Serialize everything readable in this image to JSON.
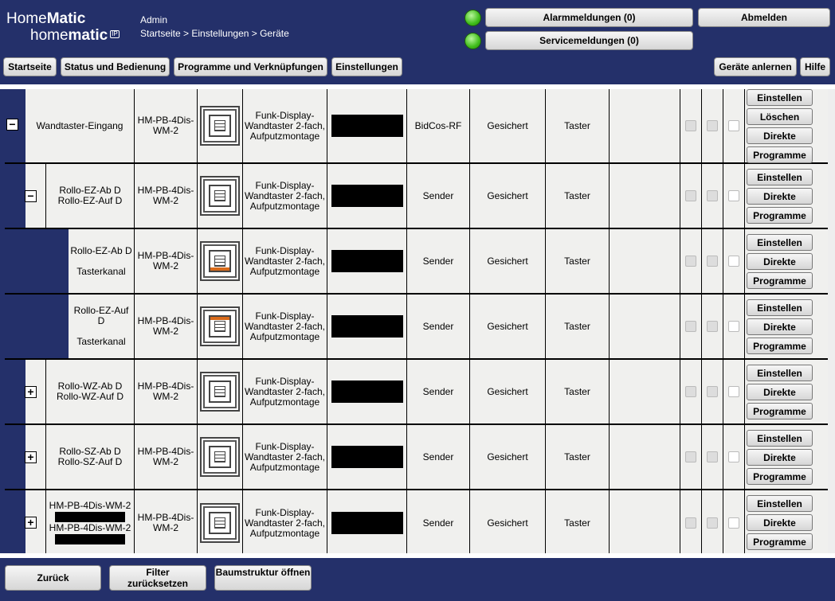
{
  "header": {
    "logo_line1_a": "Home",
    "logo_line1_b": "Matic",
    "logo_line2_a": "home",
    "logo_line2_b": "matic",
    "logo_badge": "IP",
    "user": "Admin",
    "breadcrumb": "Startseite > Einstellungen > Geräte",
    "alarm_label": "Alarmmeldungen (0)",
    "service_label": "Servicemeldungen (0)",
    "logout_label": "Abmelden"
  },
  "nav": {
    "items": [
      "Startseite",
      "Status und Bedienung",
      "Programme und Verknüpfungen",
      "Einstellungen"
    ],
    "teach_in": "Geräte anlernen",
    "help": "Hilfe"
  },
  "rows": [
    {
      "toggle": "−",
      "name1": "Wandtaster-Eingang",
      "name2": "",
      "name3": "",
      "type": "HM-PB-4Dis-WM-2",
      "desc": "Funk-Display-Wandtaster 2-fach, Aufputzmontage",
      "iface": "BidCos-RF",
      "mode": "Gesichert",
      "category": "Taster",
      "actions": [
        "Einstellen",
        "Löschen",
        "Direkte",
        "Programme"
      ]
    },
    {
      "toggle": "−",
      "name1": "Rollo-EZ-Ab D",
      "name2": "Rollo-EZ-Auf D",
      "name3": "",
      "type": "HM-PB-4Dis-WM-2",
      "desc": "Funk-Display-Wandtaster 2-fach, Aufputzmontage",
      "iface": "Sender",
      "mode": "Gesichert",
      "category": "Taster",
      "actions": [
        "Einstellen",
        "Direkte",
        "Programme"
      ]
    },
    {
      "toggle": "",
      "name1": "Rollo-EZ-Ab D",
      "name2": "",
      "name3": "Tasterkanal",
      "type": "HM-PB-4Dis-WM-2",
      "desc": "Funk-Display-Wandtaster 2-fach, Aufputzmontage",
      "iface": "Sender",
      "mode": "Gesichert",
      "category": "Taster",
      "actions": [
        "Einstellen",
        "Direkte",
        "Programme"
      ]
    },
    {
      "toggle": "",
      "name1": "Rollo-EZ-Auf D",
      "name2": "",
      "name3": "Tasterkanal",
      "type": "HM-PB-4Dis-WM-2",
      "desc": "Funk-Display-Wandtaster 2-fach, Aufputzmontage",
      "iface": "Sender",
      "mode": "Gesichert",
      "category": "Taster",
      "actions": [
        "Einstellen",
        "Direkte",
        "Programme"
      ]
    },
    {
      "toggle": "+",
      "name1": "Rollo-WZ-Ab D",
      "name2": "Rollo-WZ-Auf D",
      "name3": "",
      "type": "HM-PB-4Dis-WM-2",
      "desc": "Funk-Display-Wandtaster 2-fach, Aufputzmontage",
      "iface": "Sender",
      "mode": "Gesichert",
      "category": "Taster",
      "actions": [
        "Einstellen",
        "Direkte",
        "Programme"
      ]
    },
    {
      "toggle": "+",
      "name1": "Rollo-SZ-Ab D",
      "name2": "Rollo-SZ-Auf D",
      "name3": "",
      "type": "HM-PB-4Dis-WM-2",
      "desc": "Funk-Display-Wandtaster 2-fach, Aufputzmontage",
      "iface": "Sender",
      "mode": "Gesichert",
      "category": "Taster",
      "actions": [
        "Einstellen",
        "Direkte",
        "Programme"
      ]
    },
    {
      "toggle": "+",
      "name1": "HM-PB-4Dis-WM-2",
      "name2": "HM-PB-4Dis-WM-2",
      "name3": "",
      "type": "HM-PB-4Dis-WM-2",
      "desc": "Funk-Display-Wandtaster 2-fach, Aufputzmontage",
      "iface": "Sender",
      "mode": "Gesichert",
      "category": "Taster",
      "actions": [
        "Einstellen",
        "Direkte",
        "Programme"
      ]
    }
  ],
  "footer": {
    "back": "Zurück",
    "reset_filter_1": "Filter",
    "reset_filter_2": "zurücksetzen",
    "open_tree": "Baumstruktur öffnen"
  }
}
